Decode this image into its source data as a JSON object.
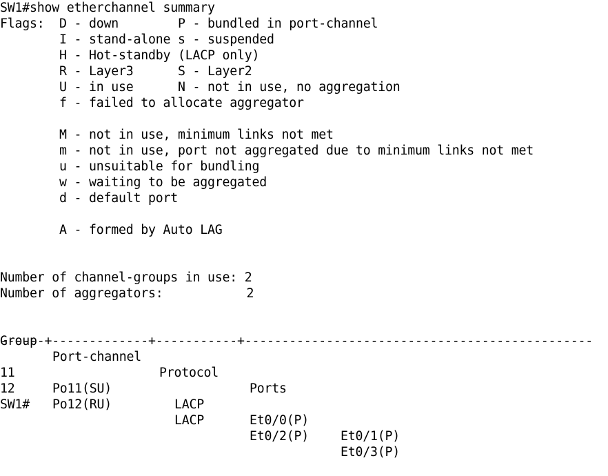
{
  "terminal": {
    "prompt": "SW1#",
    "command": "show etherchannel summary",
    "flags_header": "Flags:",
    "flag_lines": [
      "Flags:  D - down        P - bundled in port-channel",
      "        I - stand-alone s - suspended",
      "        H - Hot-standby (LACP only)",
      "        R - Layer3      S - Layer2",
      "        U - in use      N - not in use, no aggregation",
      "        f - failed to allocate aggregator",
      "",
      "        M - not in use, minimum links not met",
      "        m - not in use, port not aggregated due to minimum links not met",
      "        u - unsuitable for bundling",
      "        w - waiting to be aggregated",
      "        d - default port",
      "",
      "        A - formed by Auto LAG"
    ],
    "summary": {
      "channel_groups_label": "Number of channel-groups in use:",
      "channel_groups_value": "2",
      "aggregators_label": "Number of aggregators:",
      "aggregators_value": "2"
    },
    "table": {
      "headers": [
        "Group",
        "Port-channel",
        "Protocol",
        "Ports"
      ],
      "separator": "------+-------------+-----------+-----------------------------------------------",
      "rows": [
        {
          "group": "11",
          "port_channel": "Po11(SU)",
          "protocol": "LACP",
          "ports": [
            "Et0/0(P)",
            "Et0/1(P)"
          ]
        },
        {
          "group": "12",
          "port_channel": "Po12(RU)",
          "protocol": "LACP",
          "ports": [
            "Et0/2(P)",
            "Et0/3(P)"
          ]
        }
      ]
    },
    "final_prompt": "SW1#"
  }
}
